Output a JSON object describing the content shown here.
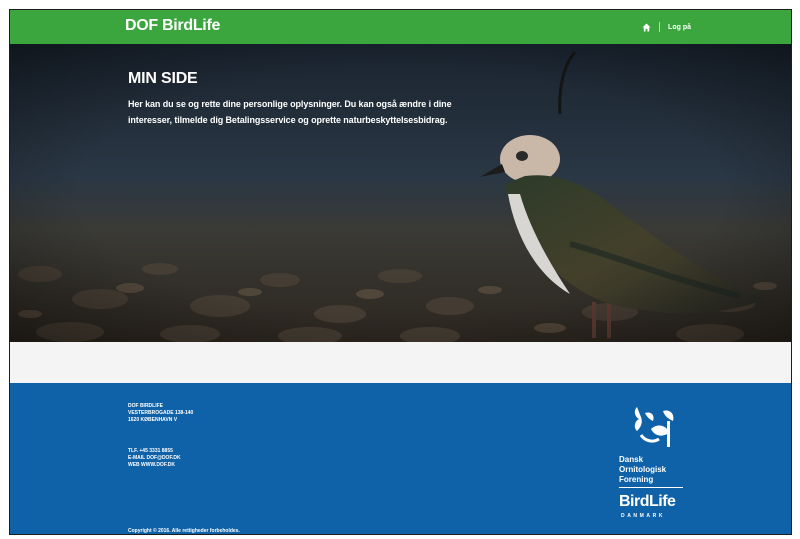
{
  "header": {
    "brand": "DOF BirdLife",
    "home_icon": "home-icon",
    "login_label": "Log på"
  },
  "hero": {
    "title": "MIN SIDE",
    "lead": "Her kan du se og rette dine personlige oplysninger. Du kan også ændre i dine interesser, tilmelde dig Betalingsservice og oprette naturbeskyttelsesbidrag."
  },
  "footer": {
    "address": [
      "DOF BIRDLIFE",
      "VESTERBROGADE 138-140",
      "1620 KØBENHAVN V"
    ],
    "contact": [
      "TLF. +45 3331 8855",
      "E-MAIL DOF@DOF.DK",
      "WEB WWW.DOF.DK"
    ],
    "copyright": "Copyright © 2016. Alle rettigheder forbeholdes.",
    "logo": {
      "name_lines": [
        "Dansk",
        "Ornitologisk",
        "Forening"
      ],
      "birdlife": "BirdLife",
      "country": "DANMARK"
    }
  },
  "colors": {
    "header_green": "#3aa63d",
    "footer_blue": "#0f62a8",
    "band_grey": "#f4f4f4"
  }
}
